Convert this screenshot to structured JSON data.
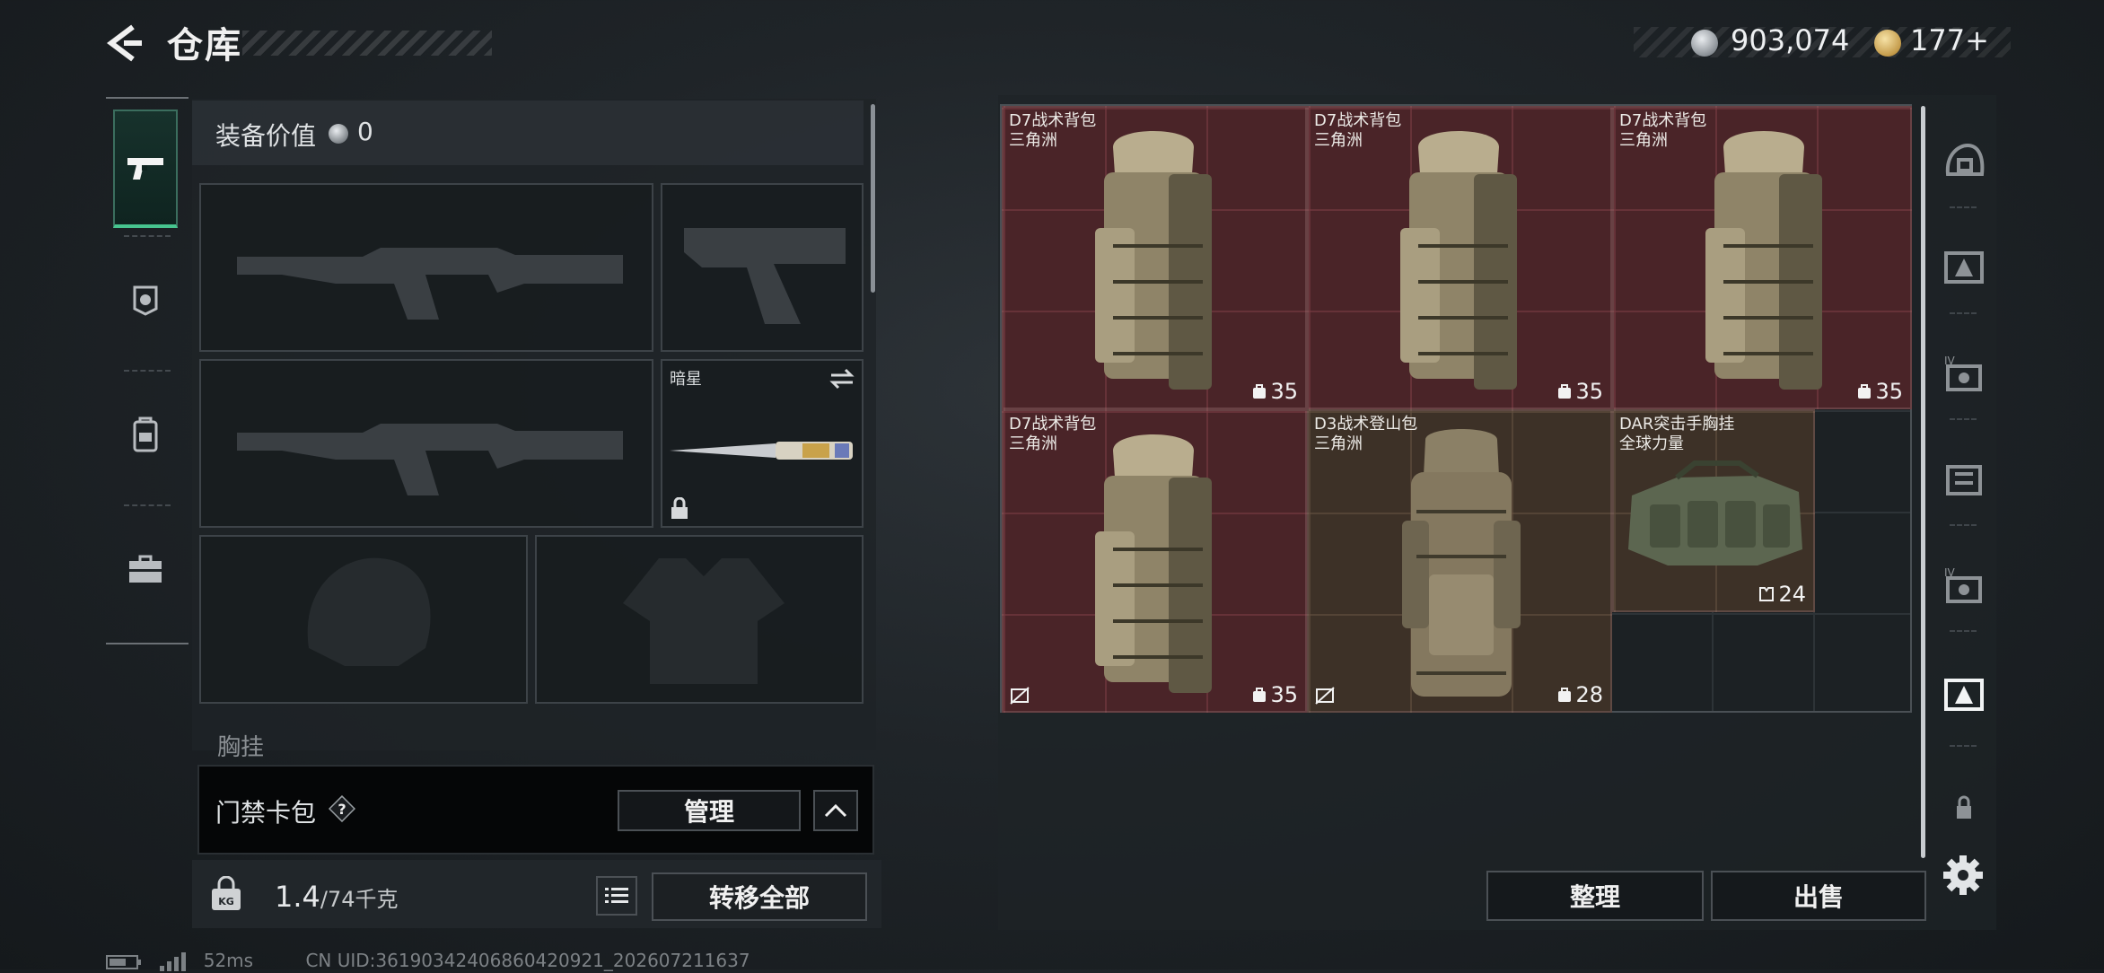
{
  "header": {
    "title": "仓库",
    "currency": {
      "silver": "903,074",
      "gold": "177+"
    }
  },
  "left_nav": {
    "items": [
      "pistol-icon",
      "armor-icon",
      "backpack-icon",
      "toolbox-icon"
    ],
    "active_index": 0
  },
  "loadout": {
    "equip_value_label": "装备价值",
    "equip_value": "0",
    "melee_slot_label": "暗星",
    "chest_rig_label": "胸挂"
  },
  "keycard": {
    "label": "门禁卡包",
    "help": "?",
    "manage_label": "管理"
  },
  "weight": {
    "current": "1.4",
    "max": "/74千克",
    "transfer_label": "转移全部"
  },
  "status_bar": {
    "ping": "52ms",
    "uid": "CN UID:361903424068604209​21_202607211637"
  },
  "storage": {
    "items": [
      {
        "name": "D7战术背包",
        "sub": "三角洲",
        "capacity": "35",
        "color": "red"
      },
      {
        "name": "D7战术背包",
        "sub": "三角洲",
        "capacity": "35",
        "color": "red"
      },
      {
        "name": "D7战术背包",
        "sub": "三角洲",
        "capacity": "35",
        "color": "red"
      },
      {
        "name": "D7战术背包",
        "sub": "三角洲",
        "capacity": "35",
        "color": "red"
      },
      {
        "name": "D3战术登山包",
        "sub": "三角洲",
        "capacity": "28",
        "color": "brown"
      },
      {
        "name": "DAR突击手胸挂",
        "sub": "全球力量",
        "capacity": "24",
        "color": "brown"
      }
    ],
    "sort_label": "整理",
    "sell_label": "出售"
  },
  "right_rail": [
    "helmet-icon",
    "armor-tier-icon",
    "armor-iv-icon",
    "rig-icon",
    "armor-iv-icon-2",
    "armor-active-icon",
    "lock-icon"
  ]
}
